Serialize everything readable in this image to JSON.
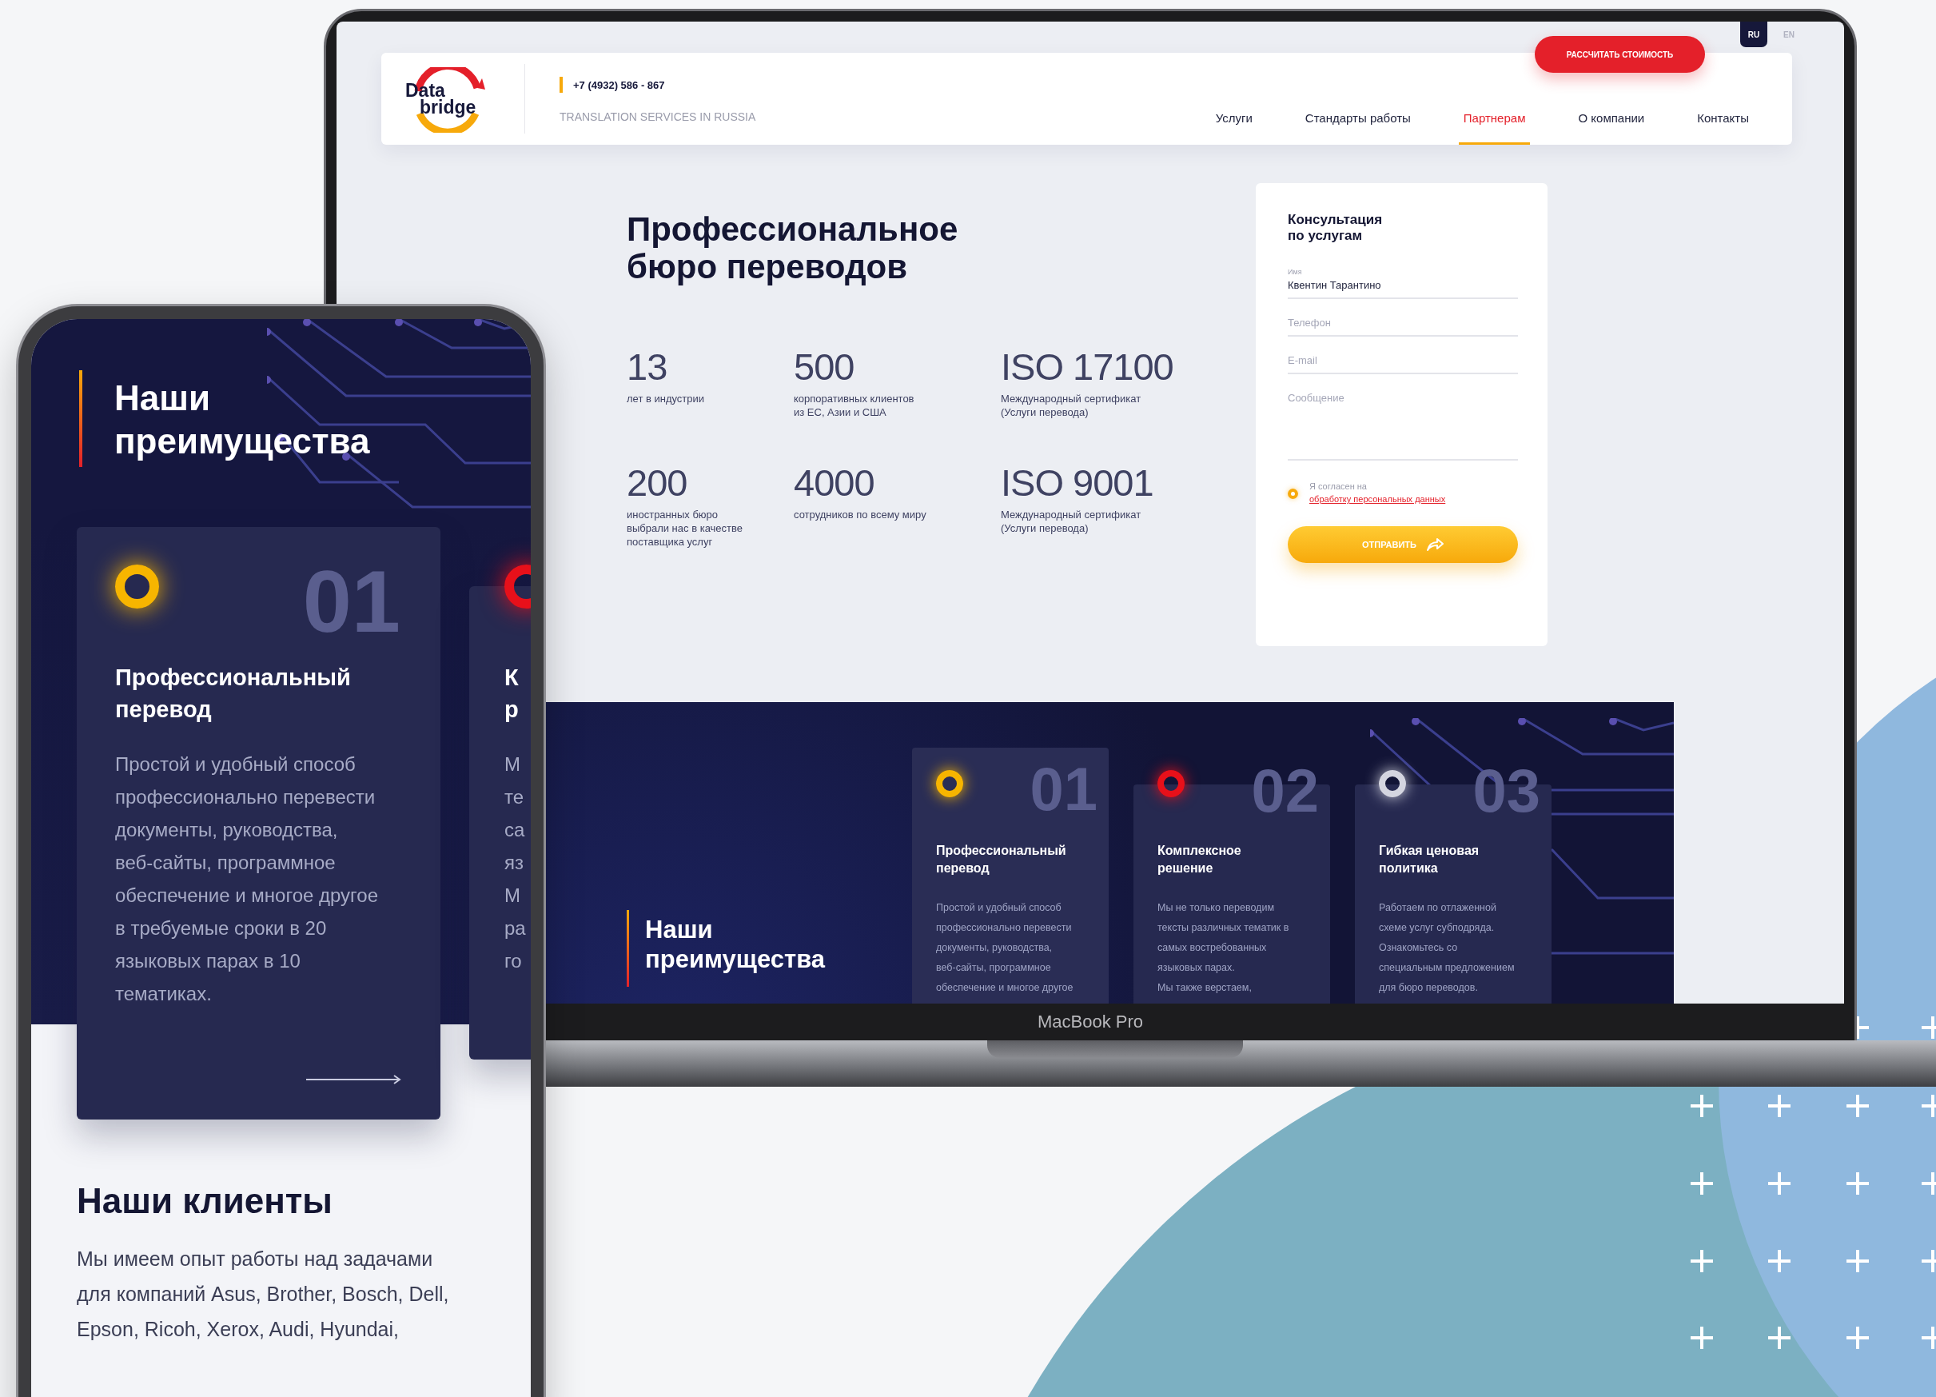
{
  "laptop": {
    "languages": [
      {
        "label": "RU",
        "selected": true
      },
      {
        "label": "EN",
        "selected": false
      }
    ],
    "header": {
      "logo": {
        "line_1": "Data",
        "line_2": "bridge"
      },
      "phone": "+7 (4932) 586 - 867",
      "tagline": "TRANSLATION SERVICES IN RUSSIA",
      "cta_button": "РАССЧИТАТЬ СТОИМОСТЬ",
      "nav": [
        {
          "label": "Услуги",
          "selected": false
        },
        {
          "label": "Стандарты работы",
          "selected": false
        },
        {
          "label": "Партнерам",
          "selected": true
        },
        {
          "label": "О компании",
          "selected": false
        },
        {
          "label": "Контакты",
          "selected": false
        }
      ]
    },
    "hero": {
      "title": "Профессиональное бюро переводов",
      "stats": [
        {
          "value": "13",
          "caption_lines": [
            "лет в индустрии"
          ]
        },
        {
          "value": "500",
          "caption_lines": [
            "корпоративных клиентов",
            "из ЕС, Азии и США"
          ]
        },
        {
          "value": "ISO 17100",
          "caption_lines": [
            "Международный сертификат",
            "(Услуги перевода)"
          ]
        },
        {
          "value": "200",
          "caption_lines": [
            "иностранных бюро",
            "выбрали нас в качестве",
            "поставщика услуг"
          ]
        },
        {
          "value": "4000",
          "caption_lines": [
            "сотрудников по всему миру"
          ]
        },
        {
          "value": "ISO 9001",
          "caption_lines": [
            "Международный сертификат",
            "(Услуги перевода)"
          ]
        }
      ]
    },
    "form": {
      "title": "Консультация по услугам",
      "fields": [
        {
          "kind": "input",
          "label": "Имя",
          "value": "Квентин Тарантино"
        },
        {
          "kind": "input",
          "placeholder": "Телефон"
        },
        {
          "kind": "input",
          "placeholder": "E-mail"
        },
        {
          "kind": "textarea",
          "placeholder": "Сообщение"
        }
      ],
      "consent": {
        "checked": true,
        "text": "Я согласен на",
        "link": "обработку персональных данных"
      },
      "submit_button": "ОТПРАВИТЬ"
    },
    "advantages": {
      "title": "Наши преимущества",
      "cards": [
        {
          "number": "01",
          "color": "#f7b500",
          "title": "Профессиональный перевод",
          "body_lines": [
            "Простой и удобный способ",
            "профессионально перевести",
            "документы, руководства,",
            "веб-сайты, программное",
            "обеспечение и многое другое"
          ]
        },
        {
          "number": "02",
          "color": "#e8101a",
          "title": "Комплексное решение",
          "body_lines": [
            "Мы не только переводим",
            "тексты различных тематик в",
            "самых востребованных",
            "языковых парах.",
            "Мы также верстаем,"
          ]
        },
        {
          "number": "03",
          "color": "#d4d5e0",
          "title": "Гибкая ценовая политика",
          "body_lines": [
            "Работаем по отлаженной",
            "схеме услуг субподряда.",
            "Ознакомьтесь со",
            "специальным предложением",
            "для бюро переводов."
          ]
        }
      ]
    },
    "model_label": "MacBook Pro"
  },
  "phone": {
    "advantages_title": "Наши преимущества",
    "cards": [
      {
        "number": "01",
        "color": "#f7b500",
        "title_lines": [
          "Профессиональный",
          "перевод"
        ],
        "body_lines": [
          "Простой и удобный способ",
          "профессионально перевести",
          "документы, руководства,",
          "веб-сайты, программное",
          "обеспечение и многое другое",
          "в требуемые сроки в 20",
          "языковых парах в 10",
          "тематиках."
        ]
      },
      {
        "color": "#e8101a",
        "title_lines": [
          "К",
          "р"
        ],
        "body_lines": [
          "М",
          "те",
          "са",
          "яз",
          "М",
          "ра",
          "го"
        ]
      }
    ],
    "clients": {
      "title": "Наши клиенты",
      "text_lines": [
        "Мы имеем опыт работы над задачами",
        "для компаний Asus, Brother, Bosch, Dell,",
        "Epson, Ricoh, Xerox, Audi, Hyundai,"
      ]
    }
  }
}
